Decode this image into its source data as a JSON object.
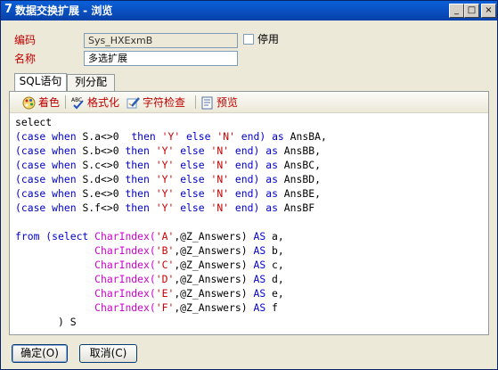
{
  "window": {
    "title": "数据交换扩展 - 浏览",
    "title_icon": "7",
    "min_label": "_",
    "max_label": "□",
    "close_label": "×"
  },
  "form": {
    "code_label": "编码",
    "code_value": "Sys_HXExmB",
    "name_label": "名称",
    "name_value": "多选扩展",
    "disable_label": "停用",
    "disable_checked": false
  },
  "tabs": [
    {
      "label": "SQL语句",
      "active": true
    },
    {
      "label": "列分配",
      "active": false
    }
  ],
  "toolbar": {
    "color_label": "着色",
    "format_label": "格式化",
    "charcheck_label": "字符检查",
    "preview_label": "预览"
  },
  "sql_lines": [
    [
      [
        "p",
        "select"
      ]
    ],
    [
      [
        "k",
        "(case when "
      ],
      [
        "p",
        "S.a<>0  "
      ],
      [
        "k",
        "then "
      ],
      [
        "s",
        "'Y' "
      ],
      [
        "k",
        "else "
      ],
      [
        "s",
        "'N' "
      ],
      [
        "k",
        "end) as "
      ],
      [
        "p",
        "AnsBA,"
      ]
    ],
    [
      [
        "k",
        "(case when "
      ],
      [
        "p",
        "S.b<>0 "
      ],
      [
        "k",
        "then "
      ],
      [
        "s",
        "'Y' "
      ],
      [
        "k",
        "else "
      ],
      [
        "s",
        "'N' "
      ],
      [
        "k",
        "end) as "
      ],
      [
        "p",
        "AnsBB,"
      ]
    ],
    [
      [
        "k",
        "(case when "
      ],
      [
        "p",
        "S.c<>0 "
      ],
      [
        "k",
        "then "
      ],
      [
        "s",
        "'Y' "
      ],
      [
        "k",
        "else "
      ],
      [
        "s",
        "'N' "
      ],
      [
        "k",
        "end) as "
      ],
      [
        "p",
        "AnsBC,"
      ]
    ],
    [
      [
        "k",
        "(case when "
      ],
      [
        "p",
        "S.d<>0 "
      ],
      [
        "k",
        "then "
      ],
      [
        "s",
        "'Y' "
      ],
      [
        "k",
        "else "
      ],
      [
        "s",
        "'N' "
      ],
      [
        "k",
        "end) as "
      ],
      [
        "p",
        "AnsBD,"
      ]
    ],
    [
      [
        "k",
        "(case when "
      ],
      [
        "p",
        "S.e<>0 "
      ],
      [
        "k",
        "then "
      ],
      [
        "s",
        "'Y' "
      ],
      [
        "k",
        "else "
      ],
      [
        "s",
        "'N' "
      ],
      [
        "k",
        "end) as "
      ],
      [
        "p",
        "AnsBE,"
      ]
    ],
    [
      [
        "k",
        "(case when "
      ],
      [
        "p",
        "S.f<>0 "
      ],
      [
        "k",
        "then "
      ],
      [
        "s",
        "'Y' "
      ],
      [
        "k",
        "else "
      ],
      [
        "s",
        "'N' "
      ],
      [
        "k",
        "end) as "
      ],
      [
        "p",
        "AnsBF"
      ]
    ],
    [
      [
        "p",
        ""
      ]
    ],
    [
      [
        "k",
        "from (select "
      ],
      [
        "f",
        "CharIndex("
      ],
      [
        "s",
        "'A'"
      ],
      [
        "p",
        ",@Z_Answers) "
      ],
      [
        "k",
        "AS "
      ],
      [
        "p",
        "a,"
      ]
    ],
    [
      [
        "p",
        "             "
      ],
      [
        "f",
        "CharIndex("
      ],
      [
        "s",
        "'B'"
      ],
      [
        "p",
        ",@Z_Answers) "
      ],
      [
        "k",
        "AS "
      ],
      [
        "p",
        "b,"
      ]
    ],
    [
      [
        "p",
        "             "
      ],
      [
        "f",
        "CharIndex("
      ],
      [
        "s",
        "'C'"
      ],
      [
        "p",
        ",@Z_Answers) "
      ],
      [
        "k",
        "AS "
      ],
      [
        "p",
        "c,"
      ]
    ],
    [
      [
        "p",
        "             "
      ],
      [
        "f",
        "CharIndex("
      ],
      [
        "s",
        "'D'"
      ],
      [
        "p",
        ",@Z_Answers) "
      ],
      [
        "k",
        "AS "
      ],
      [
        "p",
        "d,"
      ]
    ],
    [
      [
        "p",
        "             "
      ],
      [
        "f",
        "CharIndex("
      ],
      [
        "s",
        "'E'"
      ],
      [
        "p",
        ",@Z_Answers) "
      ],
      [
        "k",
        "AS "
      ],
      [
        "p",
        "e,"
      ]
    ],
    [
      [
        "p",
        "             "
      ],
      [
        "f",
        "CharIndex("
      ],
      [
        "s",
        "'F'"
      ],
      [
        "p",
        ",@Z_Answers) "
      ],
      [
        "k",
        "AS "
      ],
      [
        "p",
        "f"
      ]
    ],
    [
      [
        "p",
        "       ) S"
      ]
    ]
  ],
  "buttons": {
    "ok_label": "确定(O)",
    "cancel_label": "取消(C)"
  },
  "colors": {
    "keyword": "#0000cc",
    "string": "#cc0000",
    "function": "#cc00cc",
    "label": "#c00000"
  }
}
